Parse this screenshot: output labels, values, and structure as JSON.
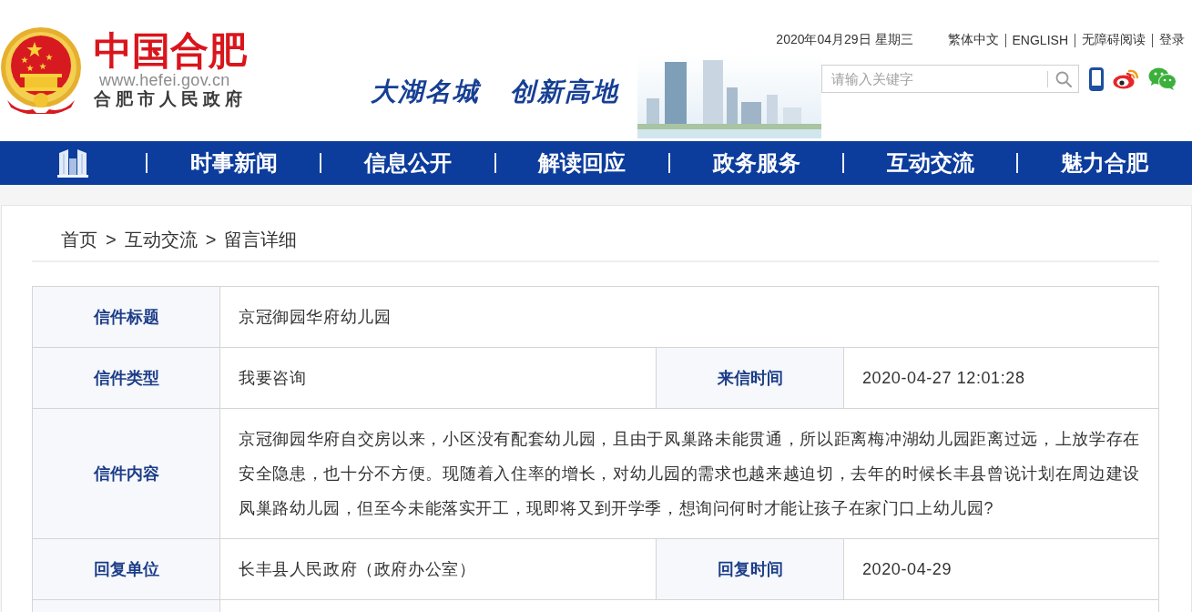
{
  "header": {
    "logo": {
      "title": "中国合肥",
      "url": "www.hefei.gov.cn",
      "subtitle": "合肥市人民政府"
    },
    "slogan": [
      "大湖名城",
      "创新高地"
    ],
    "date": "2020年04月29日 星期三",
    "links": [
      "繁体中文",
      "ENGLISH",
      "无障碍阅读",
      "登录"
    ],
    "search": {
      "placeholder": "请输入关键字"
    }
  },
  "nav": {
    "items": [
      "时事新闻",
      "信息公开",
      "解读回应",
      "政务服务",
      "互动交流",
      "魅力合肥"
    ]
  },
  "breadcrumb": {
    "items": [
      "首页",
      "互动交流",
      "留言详细"
    ],
    "separator": ">"
  },
  "table": {
    "rows": [
      {
        "cells": [
          {
            "kind": "label",
            "text": "信件标题"
          },
          {
            "kind": "value",
            "text": "京冠御园华府幼儿园",
            "colspan": 3
          }
        ]
      },
      {
        "cells": [
          {
            "kind": "label",
            "text": "信件类型"
          },
          {
            "kind": "value",
            "text": "我要咨询"
          },
          {
            "kind": "label",
            "text": "来信时间"
          },
          {
            "kind": "value",
            "text": "2020-04-27 12:01:28"
          }
        ]
      },
      {
        "cells": [
          {
            "kind": "label",
            "text": "信件内容"
          },
          {
            "kind": "value",
            "text": "京冠御园华府自交房以来，小区没有配套幼儿园，且由于凤巢路未能贯通，所以距离梅冲湖幼儿园距离过远，上放学存在安全隐患，也十分不方便。现随着入住率的增长，对幼儿园的需求也越来越迫切，去年的时候长丰县曾说计划在周边建设凤巢路幼儿园，但至今未能落实开工，现即将又到开学季，想询问何时才能让孩子在家门口上幼儿园?",
            "colspan": 3
          }
        ]
      },
      {
        "cells": [
          {
            "kind": "label",
            "text": "回复单位"
          },
          {
            "kind": "value",
            "text": "长丰县人民政府（政府办公室）"
          },
          {
            "kind": "label",
            "text": "回复时间"
          },
          {
            "kind": "value",
            "text": "2020-04-29"
          }
        ]
      },
      {
        "cells": [
          {
            "kind": "label"
          },
          {
            "kind": "value",
            "colspan": 3
          }
        ]
      }
    ]
  }
}
